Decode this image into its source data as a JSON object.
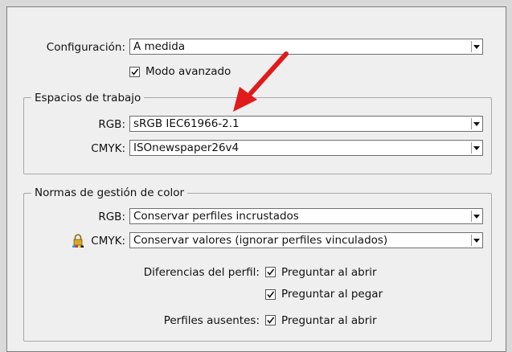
{
  "general": {
    "config_label": "Configuración:",
    "config_value": "A medida",
    "advanced_label": "Modo avanzado"
  },
  "workspaces": {
    "title": "Espacios de trabajo",
    "rgb_label": "RGB:",
    "rgb_value": "sRGB IEC61966-2.1",
    "cmyk_label": "CMYK:",
    "cmyk_value": "ISOnewspaper26v4"
  },
  "policies": {
    "title": "Normas de gestión de color",
    "rgb_label": "RGB:",
    "rgb_value": "Conservar perfiles incrustados",
    "cmyk_label": "CMYK:",
    "cmyk_value": "Conservar valores (ignorar perfiles vinculados)",
    "mismatch_label": "Diferencias del perfil:",
    "ask_open_label": "Preguntar al abrir",
    "ask_paste_label": "Preguntar al pegar",
    "missing_label": "Perfiles ausentes:",
    "missing_ask_open_label": "Preguntar al abrir"
  },
  "colors": {
    "annotation_arrow": "#e01b1b"
  }
}
